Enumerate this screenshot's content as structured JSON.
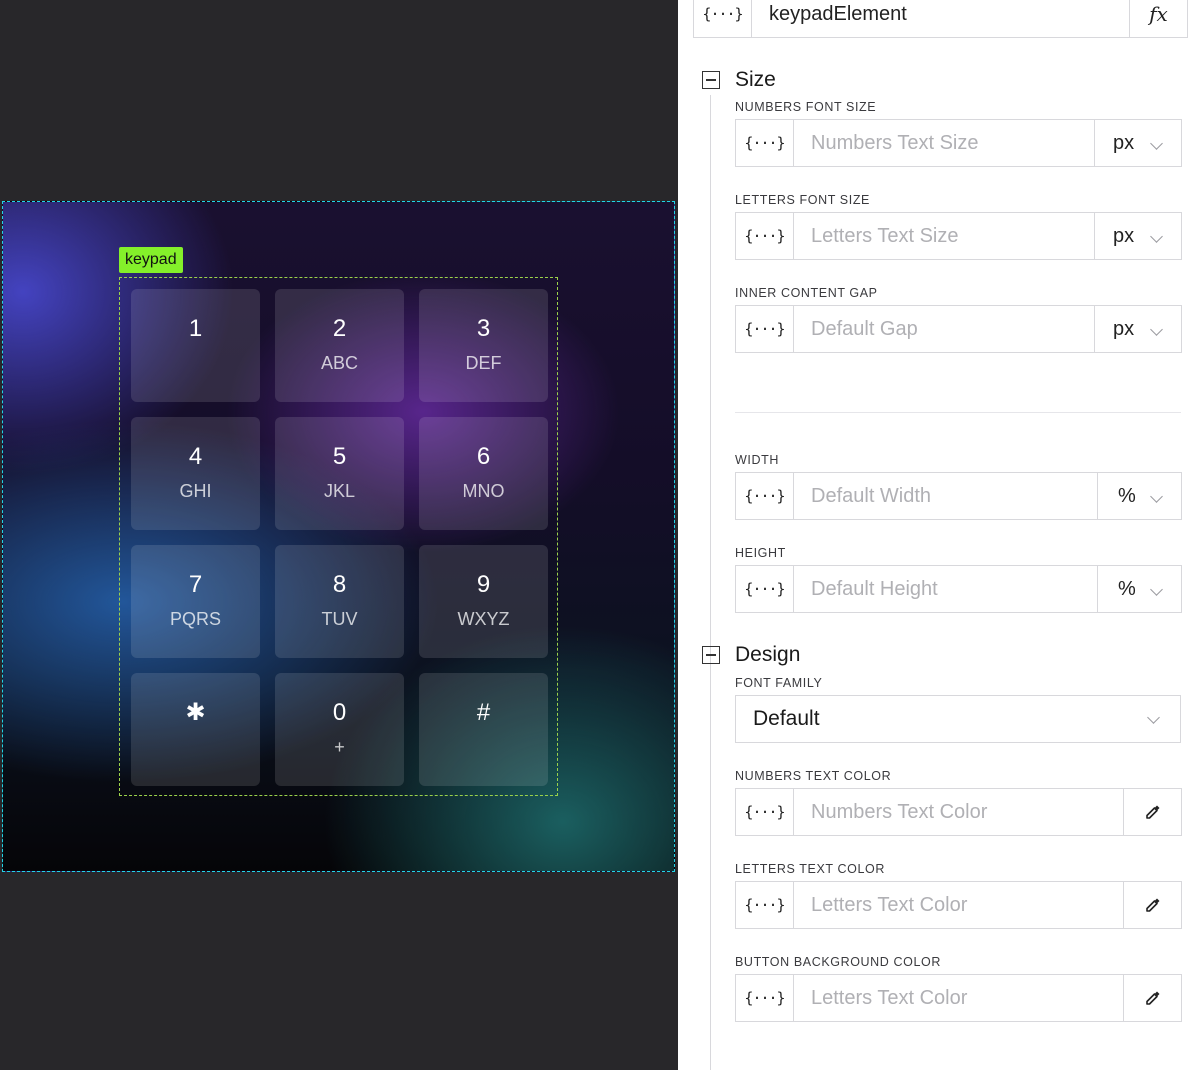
{
  "canvas": {
    "keypad_tag": "keypad",
    "keys": [
      {
        "num": "1",
        "letters": ""
      },
      {
        "num": "2",
        "letters": "ABC"
      },
      {
        "num": "3",
        "letters": "DEF"
      },
      {
        "num": "4",
        "letters": "GHI"
      },
      {
        "num": "5",
        "letters": "JKL"
      },
      {
        "num": "6",
        "letters": "MNO"
      },
      {
        "num": "7",
        "letters": "PQRS"
      },
      {
        "num": "8",
        "letters": "TUV"
      },
      {
        "num": "9",
        "letters": "WXYZ"
      },
      {
        "num": "✱",
        "letters": ""
      },
      {
        "num": "0",
        "letters": "+"
      },
      {
        "num": "#",
        "letters": ""
      }
    ],
    "colors": {
      "frame_border": "#22d3e6",
      "tag_bg": "#84f02a",
      "keypad_border": "#9bd24a"
    }
  },
  "panel": {
    "name_field": {
      "fx_symbol": "{···}",
      "value": "keypadElement",
      "formula_symbol": "fx"
    },
    "size": {
      "title": "Size",
      "numbers_font_size": {
        "label": "NUMBERS FONT SIZE",
        "placeholder": "Numbers Text Size",
        "unit": "px"
      },
      "letters_font_size": {
        "label": "LETTERS FONT SIZE",
        "placeholder": "Letters Text Size",
        "unit": "px"
      },
      "inner_gap": {
        "label": "INNER CONTENT GAP",
        "placeholder": "Default Gap",
        "unit": "px"
      },
      "width": {
        "label": "WIDTH",
        "placeholder": "Default Width",
        "unit": "%"
      },
      "height": {
        "label": "HEIGHT",
        "placeholder": "Default Height",
        "unit": "%"
      }
    },
    "design": {
      "title": "Design",
      "font_family": {
        "label": "FONT FAMILY",
        "value": "Default"
      },
      "numbers_color": {
        "label": "NUMBERS TEXT COLOR",
        "placeholder": "Numbers Text Color"
      },
      "letters_color": {
        "label": "LETTERS TEXT COLOR",
        "placeholder": "Letters Text Color"
      },
      "button_bg": {
        "label": "BUTTON BACKGROUND COLOR",
        "placeholder": "Letters Text Color"
      }
    },
    "fx_symbol": "{···}"
  }
}
